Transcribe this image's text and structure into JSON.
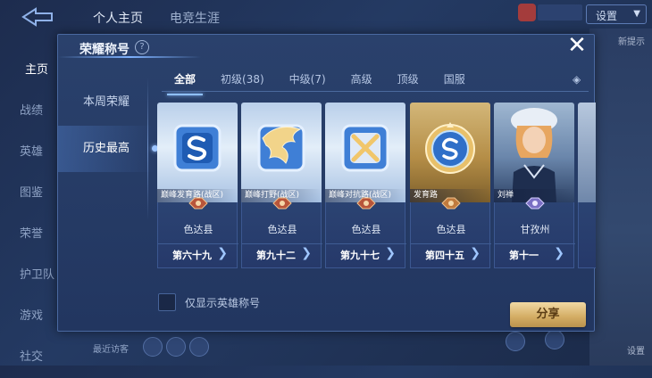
{
  "background": {
    "top_nav": [
      "个人主页",
      "电竞生涯"
    ],
    "dropdown_label": "设置",
    "side_nav": [
      "主页",
      "战绩",
      "英雄",
      "图鉴",
      "荣誉",
      "护卫队",
      "游戏",
      "社交"
    ],
    "bottom_text": "最近访客",
    "right_labels": [
      "新提示",
      "设置"
    ]
  },
  "dialog": {
    "title": "荣耀称号",
    "help_icon": "question-icon",
    "close_icon": "close-icon",
    "side_tabs": [
      {
        "label": "本周荣耀",
        "active": false
      },
      {
        "label": "历史最高",
        "active": true
      }
    ],
    "tabs": [
      {
        "label": "全部",
        "active": true
      },
      {
        "label": "初级(38)",
        "active": false
      },
      {
        "label": "中级(7)",
        "active": false
      },
      {
        "label": "高级",
        "active": false
      },
      {
        "label": "顶级",
        "active": false
      },
      {
        "label": "国服",
        "active": false
      }
    ],
    "cards": [
      {
        "title": "巅峰发育路(战区)",
        "region": "色达县",
        "rank": "第六十九",
        "style": "blue",
        "icon": "s-shield-icon",
        "badge_color": "#b8553a"
      },
      {
        "title": "巅峰打野(战区)",
        "region": "色达县",
        "rank": "第九十二",
        "style": "blue",
        "icon": "dragon-icon",
        "badge_color": "#b8553a"
      },
      {
        "title": "巅峰对抗路(战区)",
        "region": "色达县",
        "rank": "第九十七",
        "style": "blue",
        "icon": "crossed-swords-icon",
        "badge_color": "#b8553a"
      },
      {
        "title": "发育路",
        "region": "色达县",
        "rank": "第四十五",
        "style": "gold",
        "icon": "gold-emblem-icon",
        "badge_color": "#c07a3d"
      },
      {
        "title": "刘禅",
        "region": "甘孜州",
        "rank": "第十一",
        "style": "hero",
        "icon": "hero-portrait",
        "badge_color": "#7a6fc4"
      }
    ],
    "checkbox_label": "仅显示英雄称号",
    "share_label": "分享"
  }
}
